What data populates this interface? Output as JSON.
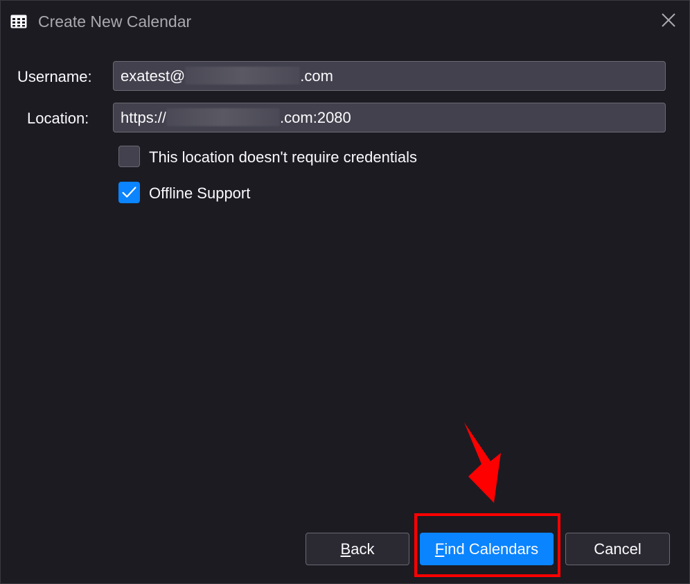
{
  "window": {
    "title": "Create New Calendar"
  },
  "form": {
    "username": {
      "label": "Username:",
      "value_prefix": "exatest@",
      "value_suffix": ".com"
    },
    "location": {
      "label": "Location:",
      "value_prefix": "https://",
      "value_suffix": ".com:2080"
    },
    "no_credentials": {
      "label": "This location doesn't require credentials",
      "checked": false
    },
    "offline_support": {
      "label": "Offline Support",
      "checked": true
    }
  },
  "buttons": {
    "back": "Back",
    "find_calendars": "Find Calendars",
    "cancel": "Cancel"
  },
  "annotation": {
    "color": "#ff0000"
  },
  "theme": {
    "accent": "#0a84ff",
    "background": "#1c1b22",
    "field_background": "#42414d"
  },
  "icons": {
    "app": "calendar-grid-icon",
    "close": "close-icon",
    "check": "checkmark-icon",
    "annotation": "red-down-arrow-icon"
  }
}
